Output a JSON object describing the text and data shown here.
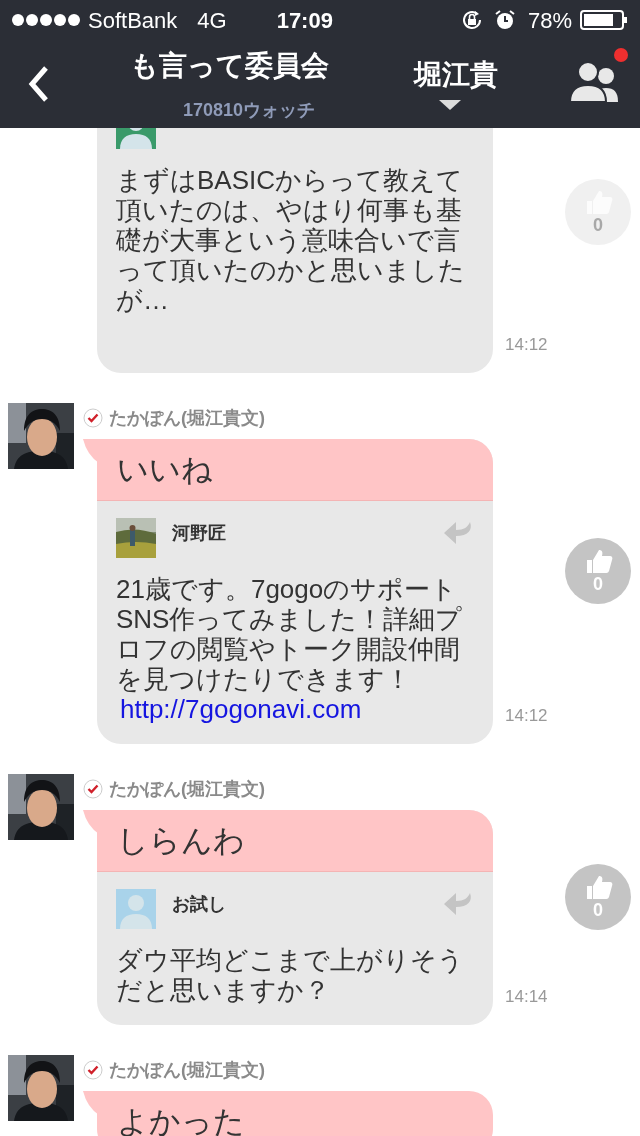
{
  "status_bar": {
    "carrier": "SoftBank",
    "network": "4G",
    "time": "17:09",
    "battery": "78%"
  },
  "header": {
    "title": "も言って委員会",
    "subtitle": "170810ウォッチ",
    "member": "堀江貴",
    "notification": true
  },
  "messages": [
    {
      "quote": {
        "avatar": {
          "kind": "default",
          "color": "#3a9a6a"
        },
        "text": "まずはBASICからって教えて頂いたのは、やはり何事も基礎が大事という意味合いで言って頂いたのかと思いましたが…"
      },
      "time": "14:12",
      "likes": "0",
      "faded": true
    },
    {
      "author": "たかぽん(堀江貴文)",
      "verified": true,
      "text": "いいね",
      "quote": {
        "author": "河野匠",
        "text": "21歳です。7gogoのサポートSNS作ってみました！詳細プロフの閲覧やトーク開設仲間を見つけたりできます！",
        "link": "http://7gogonavi.com"
      },
      "time": "14:12",
      "likes": "0",
      "faded": false
    },
    {
      "author": "たかぽん(堀江貴文)",
      "verified": true,
      "text": "しらんわ",
      "quote": {
        "avatar": {
          "kind": "default",
          "color": "#a9d3ea"
        },
        "author": "お試し",
        "text": "ダウ平均どこまで上がりそうだと思いますか？"
      },
      "time": "14:14",
      "likes": "0",
      "faded": false
    },
    {
      "author": "たかぽん(堀江貴文)",
      "verified": true,
      "text": "よかった"
    }
  ]
}
